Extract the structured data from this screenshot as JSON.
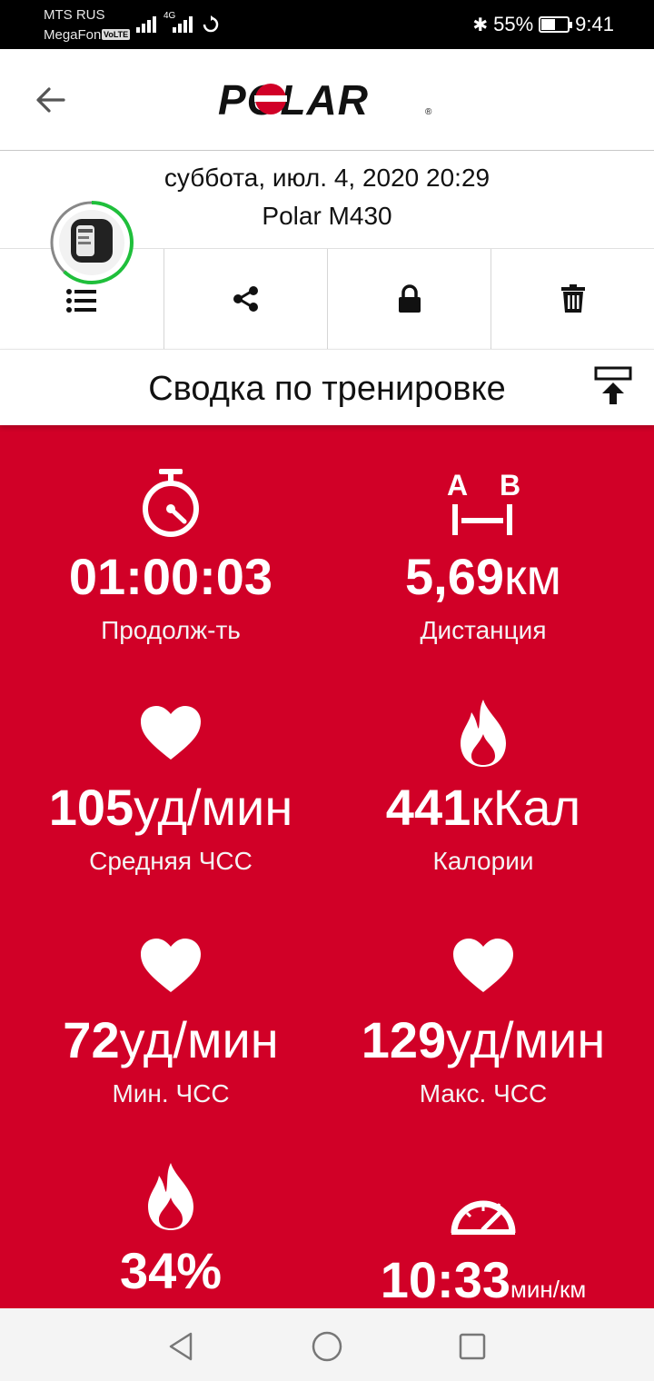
{
  "status_bar": {
    "carrier1": "MTS RUS",
    "carrier2": "MegaFon",
    "volte": "VoLTE",
    "net": "4G",
    "battery_pct": "55%",
    "battery_level": 0.55,
    "time": "9:41"
  },
  "header": {
    "logo_text": "POLAR",
    "back_icon": "arrow-left-icon"
  },
  "session": {
    "date": "суббота, июл. 4, 2020 20:29",
    "device": "Polar M430",
    "avatar_ring_progress": 0.62
  },
  "toolbar": {
    "items": [
      "list-icon",
      "share-icon",
      "lock-icon",
      "trash-icon"
    ]
  },
  "summary": {
    "title": "Сводка по тренировке"
  },
  "stats": [
    {
      "icon": "stopwatch-icon",
      "value": "01:00:03",
      "unit": "",
      "label": "Продолж-ть"
    },
    {
      "icon": "distance-ab-icon",
      "value": "5,69",
      "unit": "км",
      "label": "Дистанция"
    },
    {
      "icon": "heart-icon",
      "value": "105",
      "unit": "уд/мин",
      "label": "Средняя ЧСС"
    },
    {
      "icon": "flame-icon",
      "value": "441",
      "unit": "кКал",
      "label": "Калории"
    },
    {
      "icon": "heart-icon",
      "value": "72",
      "unit": "уд/мин",
      "label": "Мин. ЧСС"
    },
    {
      "icon": "heart-icon",
      "value": "129",
      "unit": "уд/мин",
      "label": "Макс. ЧСС"
    },
    {
      "icon": "flame-icon",
      "value": "34%",
      "unit": "",
      "label": ""
    },
    {
      "icon": "speedometer-icon",
      "value": "10:33",
      "unit": "мин/км",
      "label": ""
    }
  ],
  "colors": {
    "accent": "#d10027",
    "ring": "#1fbf3b"
  },
  "nav": [
    "back-triangle-icon",
    "home-circle-icon",
    "recents-square-icon"
  ]
}
